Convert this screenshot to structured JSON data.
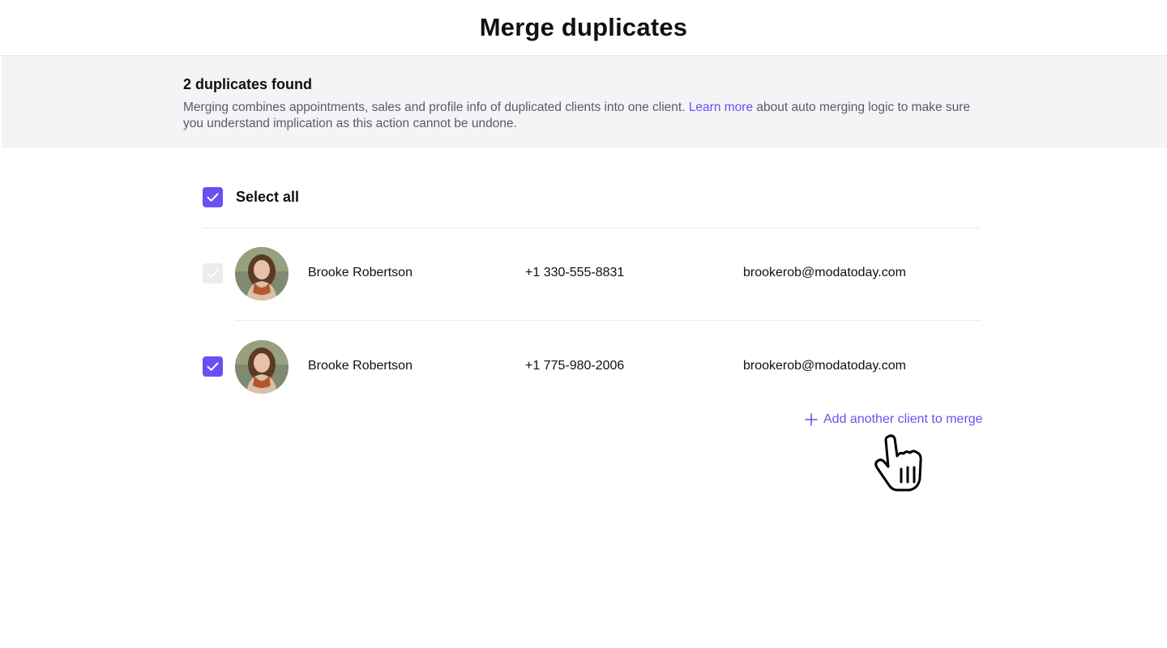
{
  "page": {
    "title": "Merge duplicates"
  },
  "banner": {
    "title": "2 duplicates found",
    "text_before": "Merging combines appointments, sales and profile info of duplicated clients into one client. ",
    "link": "Learn more",
    "text_after": " about auto merging logic to make sure you understand implication as this action cannot be undone."
  },
  "select_all": {
    "label": "Select all",
    "checked": true
  },
  "clients": [
    {
      "name": "Brooke Robertson",
      "phone": "+1 330-555-8831",
      "email": "brookerob@modatoday.com",
      "checked": true,
      "disabled": true
    },
    {
      "name": "Brooke Robertson",
      "phone": "+1 775-980-2006",
      "email": "brookerob@modatoday.com",
      "checked": true,
      "disabled": false
    }
  ],
  "add_client": {
    "label": "Add another client to merge",
    "icon": "plus-icon"
  },
  "colors": {
    "accent": "#6950f3",
    "banner_bg": "#f4f4f7",
    "muted_text": "#5a5a63"
  }
}
